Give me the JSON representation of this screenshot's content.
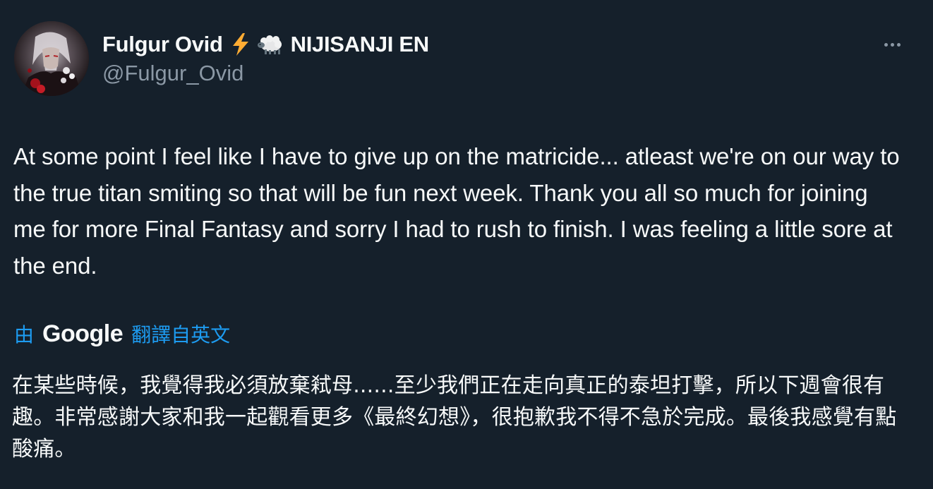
{
  "author": {
    "display_name": "Fulgur Ovid",
    "name_emojis": [
      "lightning-bolt-icon",
      "sheep-icon"
    ],
    "name_suffix": "NIJISANJI EN",
    "handle": "@Fulgur_Ovid",
    "avatar": "avatar"
  },
  "menu": {
    "more_icon": "more-options-icon"
  },
  "tweet": {
    "text": "At some point I feel like I have to give up on the matricide... atleast we're on our way to the true titan smiting so that will be fun next week. Thank you all so much for joining me for more Final Fantasy and sorry I had to rush to finish. I was feeling a little sore at the end."
  },
  "translation": {
    "by_label": "由",
    "provider": "Google",
    "translated_from": "翻譯自英文",
    "text": "在某些時候，我覺得我必須放棄弒母......至少我們正在走向真正的泰坦打擊，所以下週會很有趣。非常感謝大家和我一起觀看更多《最終幻想》，很抱歉我不得不急於完成。最後我感覺有點酸痛。"
  },
  "colors": {
    "background": "#15202b",
    "primary_text": "#f7f9f9",
    "secondary_text": "#8b98a5",
    "link": "#1d9bf0"
  }
}
